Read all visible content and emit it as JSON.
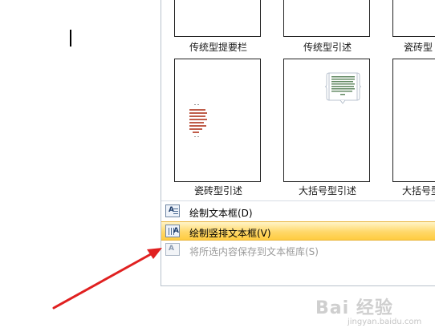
{
  "gallery": {
    "top_row_labels": [
      "传统型提要栏",
      "传统型引述",
      "瓷砖型"
    ],
    "tiles": [
      {
        "label": "瓷砖型引述"
      },
      {
        "label": "大括号型引述"
      },
      {
        "label": "大括号型"
      }
    ]
  },
  "menu": {
    "items": [
      {
        "label": "绘制文本框(D)",
        "state": "normal"
      },
      {
        "label": "绘制竖排文本框(V)",
        "state": "hover"
      },
      {
        "label": "将所选内容保存到文本框库(S)",
        "state": "disabled"
      }
    ]
  },
  "colors": {
    "hover_gradient_top": "#fff4c8",
    "hover_gradient_bottom": "#ffcc40",
    "arrow": "#e02020",
    "disabled_text": "#9b9b9b"
  },
  "watermark": {
    "main": "Bai 经验",
    "sub": "jingyan.baidu.com"
  }
}
